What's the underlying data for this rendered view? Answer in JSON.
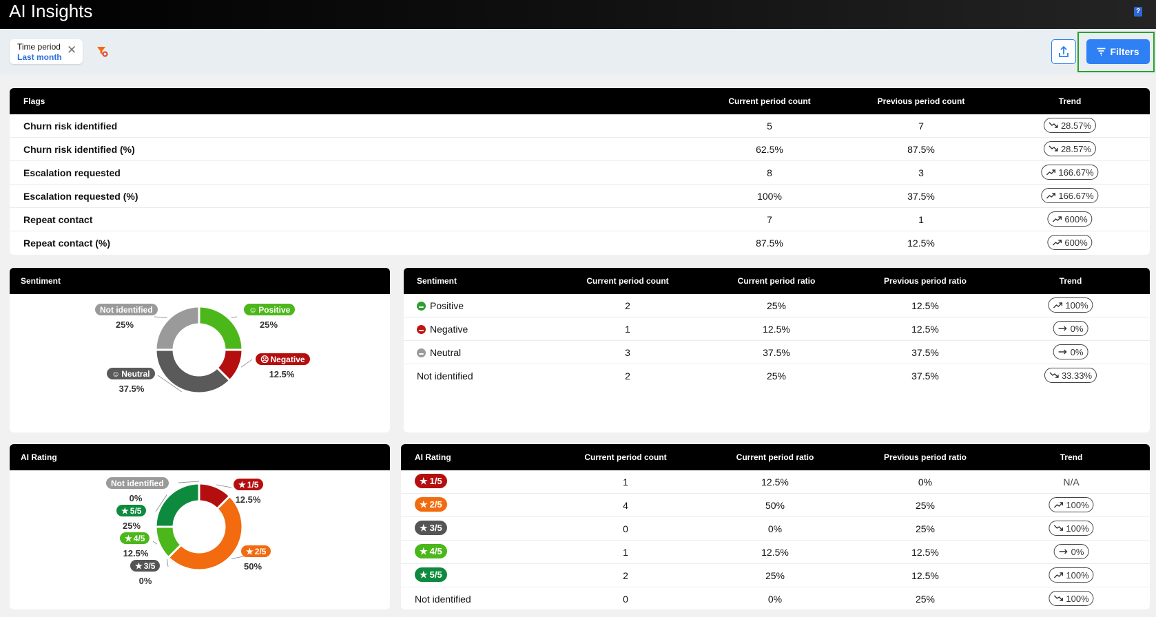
{
  "app": {
    "title": "AI Insights"
  },
  "filter_bar": {
    "chip": {
      "label": "Time period",
      "value": "Last month",
      "close": "✕"
    },
    "filters_button": "Filters"
  },
  "colors": {
    "positive": "#2e9e2e",
    "negative": "#c11515",
    "neutral": "#555555",
    "not_identified": "#9a9a9a",
    "accent": "#2f7ff5"
  },
  "flags": {
    "headers": [
      "Flags",
      "Current period count",
      "Previous period count",
      "Trend"
    ],
    "rows": [
      {
        "label": "Churn risk identified",
        "current": "5",
        "previous": "7",
        "trend": "28.57%",
        "dir": "down"
      },
      {
        "label": "Churn risk identified (%)",
        "current": "62.5%",
        "previous": "87.5%",
        "trend": "28.57%",
        "dir": "down"
      },
      {
        "label": "Escalation requested",
        "current": "8",
        "previous": "3",
        "trend": "166.67%",
        "dir": "up"
      },
      {
        "label": "Escalation requested (%)",
        "current": "100%",
        "previous": "37.5%",
        "trend": "166.67%",
        "dir": "up"
      },
      {
        "label": "Repeat contact",
        "current": "7",
        "previous": "1",
        "trend": "600%",
        "dir": "up"
      },
      {
        "label": "Repeat contact (%)",
        "current": "87.5%",
        "previous": "12.5%",
        "trend": "600%",
        "dir": "up"
      }
    ]
  },
  "sentiment_chart": {
    "title": "Sentiment",
    "chart_data": {
      "type": "pie",
      "title": "Sentiment",
      "categories": [
        "Positive",
        "Negative",
        "Neutral",
        "Not identified"
      ],
      "values": [
        25,
        12.5,
        37.5,
        25
      ],
      "value_labels": [
        "25%",
        "12.5%",
        "37.5%",
        "25%"
      ],
      "colors": [
        "#4cb71b",
        "#b50e0e",
        "#5a5a5a",
        "#9a9a9a"
      ]
    }
  },
  "sentiment_table": {
    "headers": [
      "Sentiment",
      "Current period count",
      "Current period ratio",
      "Previous period ratio",
      "Trend"
    ],
    "rows": [
      {
        "label": "Positive",
        "icon": "smile-icon",
        "color": "#2e9e2e",
        "count": "2",
        "ratio": "25%",
        "prev": "12.5%",
        "trend": "100%",
        "dir": "up"
      },
      {
        "label": "Negative",
        "icon": "frown-icon",
        "color": "#c11515",
        "count": "1",
        "ratio": "12.5%",
        "prev": "12.5%",
        "trend": "0%",
        "dir": "flat"
      },
      {
        "label": "Neutral",
        "icon": "neutral-face-icon",
        "color": "#9a9a9a",
        "count": "3",
        "ratio": "37.5%",
        "prev": "37.5%",
        "trend": "0%",
        "dir": "flat"
      },
      {
        "label": "Not identified",
        "icon": "",
        "color": "",
        "count": "2",
        "ratio": "25%",
        "prev": "37.5%",
        "trend": "33.33%",
        "dir": "down"
      }
    ]
  },
  "rating_chart": {
    "title": "AI Rating",
    "chart_data": {
      "type": "pie",
      "title": "AI Rating",
      "categories": [
        "1/5",
        "2/5",
        "3/5",
        "4/5",
        "5/5",
        "Not identified"
      ],
      "values": [
        12.5,
        50,
        0,
        12.5,
        25,
        0
      ],
      "value_labels": [
        "12.5%",
        "50%",
        "0%",
        "12.5%",
        "25%",
        "0%"
      ],
      "colors": [
        "#b50e0e",
        "#f26b0f",
        "#555555",
        "#4cb71b",
        "#0e8a3e",
        "#9a9a9a"
      ]
    }
  },
  "rating_table": {
    "headers": [
      "AI Rating",
      "Current period count",
      "Current period ratio",
      "Previous period ratio",
      "Trend"
    ],
    "rows": [
      {
        "label": "1/5",
        "badge": true,
        "color": "#b50e0e",
        "count": "1",
        "ratio": "12.5%",
        "prev": "0%",
        "trend": "N/A",
        "dir": "none"
      },
      {
        "label": "2/5",
        "badge": true,
        "color": "#f26b0f",
        "count": "4",
        "ratio": "50%",
        "prev": "25%",
        "trend": "100%",
        "dir": "up"
      },
      {
        "label": "3/5",
        "badge": true,
        "color": "#555555",
        "count": "0",
        "ratio": "0%",
        "prev": "25%",
        "trend": "100%",
        "dir": "down"
      },
      {
        "label": "4/5",
        "badge": true,
        "color": "#4cb71b",
        "count": "1",
        "ratio": "12.5%",
        "prev": "12.5%",
        "trend": "0%",
        "dir": "flat"
      },
      {
        "label": "5/5",
        "badge": true,
        "color": "#0e8a3e",
        "count": "2",
        "ratio": "25%",
        "prev": "12.5%",
        "trend": "100%",
        "dir": "up"
      },
      {
        "label": "Not identified",
        "badge": false,
        "color": "",
        "count": "0",
        "ratio": "0%",
        "prev": "25%",
        "trend": "100%",
        "dir": "down"
      }
    ]
  }
}
